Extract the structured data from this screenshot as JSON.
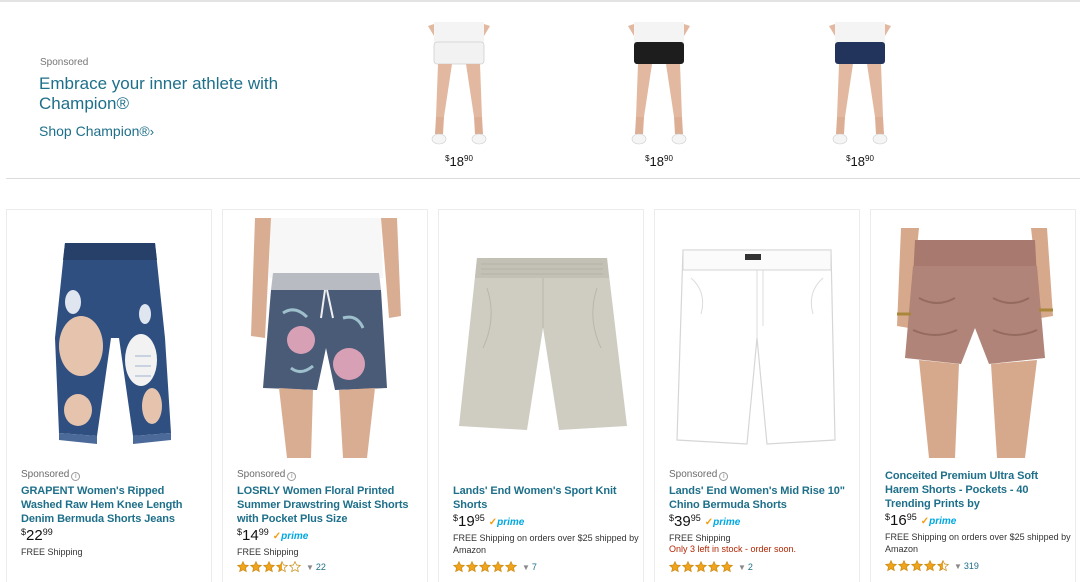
{
  "banner": {
    "sponsored": "Sponsored",
    "headline": "Embrace your inner athlete with Champion®",
    "link": "Shop Champion®",
    "link_chevron": "›",
    "products": [
      {
        "short_color": "#f2f2f2",
        "price_currency": "$",
        "price_whole": "18",
        "price_cents": "90"
      },
      {
        "short_color": "#1d1d1d",
        "price_currency": "$",
        "price_whole": "18",
        "price_cents": "90"
      },
      {
        "short_color": "#22345c",
        "price_currency": "$",
        "price_whole": "18",
        "price_cents": "90"
      }
    ]
  },
  "products": [
    {
      "sponsored": "Sponsored",
      "title": "GRAPENT Women's Ripped Washed Raw Hem Knee Length Denim Bermuda Shorts Jeans",
      "currency": "$",
      "price_whole": "22",
      "price_cents": "99",
      "shipping": "FREE Shipping",
      "image": "ripped-denim-shorts",
      "accent_color": "#2f4f80"
    },
    {
      "sponsored": "Sponsored",
      "title": "LOSRLY Women Floral Printed Summer Drawstring Waist Shorts with Pocket Plus Size",
      "currency": "$",
      "price_whole": "14",
      "price_cents": "99",
      "prime": "prime",
      "prime_tick": "✓",
      "shipping": "FREE Shipping",
      "stars": 3.5,
      "rating_count": "22",
      "image": "floral-drawstring-shorts",
      "accent_color": "#4a5b78"
    },
    {
      "title": "Lands' End Women's Sport Knit Shorts",
      "currency": "$",
      "price_whole": "19",
      "price_cents": "95",
      "prime": "prime",
      "prime_tick": "✓",
      "shipping": "FREE Shipping on orders over $25 shipped by Amazon",
      "stars": 5,
      "rating_count": "7",
      "image": "sport-knit-shorts",
      "accent_color": "#cfcdc2"
    },
    {
      "sponsored": "Sponsored",
      "title": "Lands' End Women's Mid Rise 10\" Chino Bermuda Shorts",
      "currency": "$",
      "price_whole": "39",
      "price_cents": "95",
      "prime": "prime",
      "prime_tick": "✓",
      "shipping": "FREE Shipping",
      "stock": "Only 3 left in stock - order soon.",
      "stars": 5,
      "rating_count": "2",
      "image": "white-chino-shorts",
      "accent_color": "#ffffff"
    },
    {
      "title": "Conceited Premium Ultra Soft Harem Shorts - Pockets - 40 Trending Prints by",
      "currency": "$",
      "price_whole": "16",
      "price_cents": "95",
      "prime": "prime",
      "prime_tick": "✓",
      "shipping": "FREE Shipping on orders over $25 shipped by Amazon",
      "stars": 4.5,
      "rating_count": "319",
      "image": "mauve-harem-shorts",
      "accent_color": "#b08478"
    }
  ],
  "colors": {
    "link": "#1e6f8a",
    "star": "#f0a31c",
    "prime": "#00a8e1",
    "stock_warning": "#b12704"
  }
}
